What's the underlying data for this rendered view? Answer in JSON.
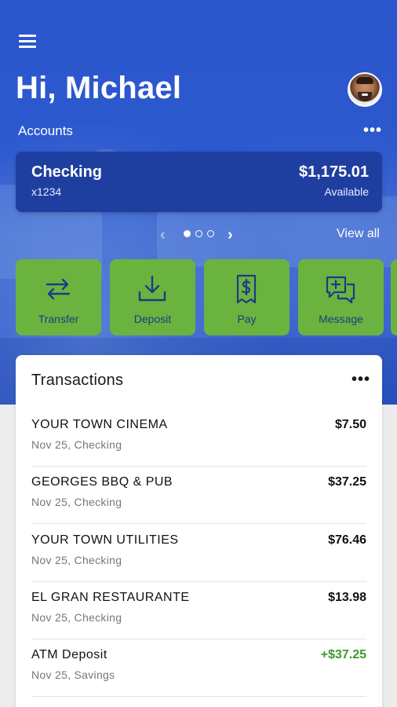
{
  "header": {
    "greeting": "Hi, Michael",
    "accounts_label": "Accounts",
    "more_glyph": "•••"
  },
  "accounts": [
    {
      "name": "Checking",
      "number": "x1234",
      "balance": "$1,175.01",
      "balance_label": "Available"
    }
  ],
  "carousel": {
    "pages": 3,
    "active": 1,
    "prev_glyph": "‹",
    "next_glyph": "›",
    "view_all": "View all"
  },
  "actions": [
    {
      "label": "Transfer",
      "icon": "transfer-arrows-icon"
    },
    {
      "label": "Deposit",
      "icon": "download-tray-icon"
    },
    {
      "label": "Pay",
      "icon": "dollar-receipt-icon"
    },
    {
      "label": "Message",
      "icon": "chat-plus-icon"
    }
  ],
  "transactions": {
    "title": "Transactions",
    "more_glyph": "•••",
    "items": [
      {
        "name": "YOUR TOWN CINEMA",
        "amount": "$7.50",
        "meta": "Nov 25, Checking",
        "credit": false
      },
      {
        "name": "GEORGES BBQ & PUB",
        "amount": "$37.25",
        "meta": "Nov 25, Checking",
        "credit": false
      },
      {
        "name": "YOUR TOWN UTILITIES",
        "amount": "$76.46",
        "meta": "Nov 25, Checking",
        "credit": false
      },
      {
        "name": "EL GRAN RESTAURANTE",
        "amount": "$13.98",
        "meta": "Nov 25, Checking",
        "credit": false
      },
      {
        "name": "ATM Deposit",
        "amount": "+$37.25",
        "meta": "Nov 25, Savings",
        "credit": true
      }
    ]
  },
  "colors": {
    "hero_blue": "#2d59cf",
    "card_navy": "#1f3fa0",
    "action_green": "#6bb33f",
    "action_label": "#1e3a86",
    "credit_green": "#3a9a2a"
  }
}
